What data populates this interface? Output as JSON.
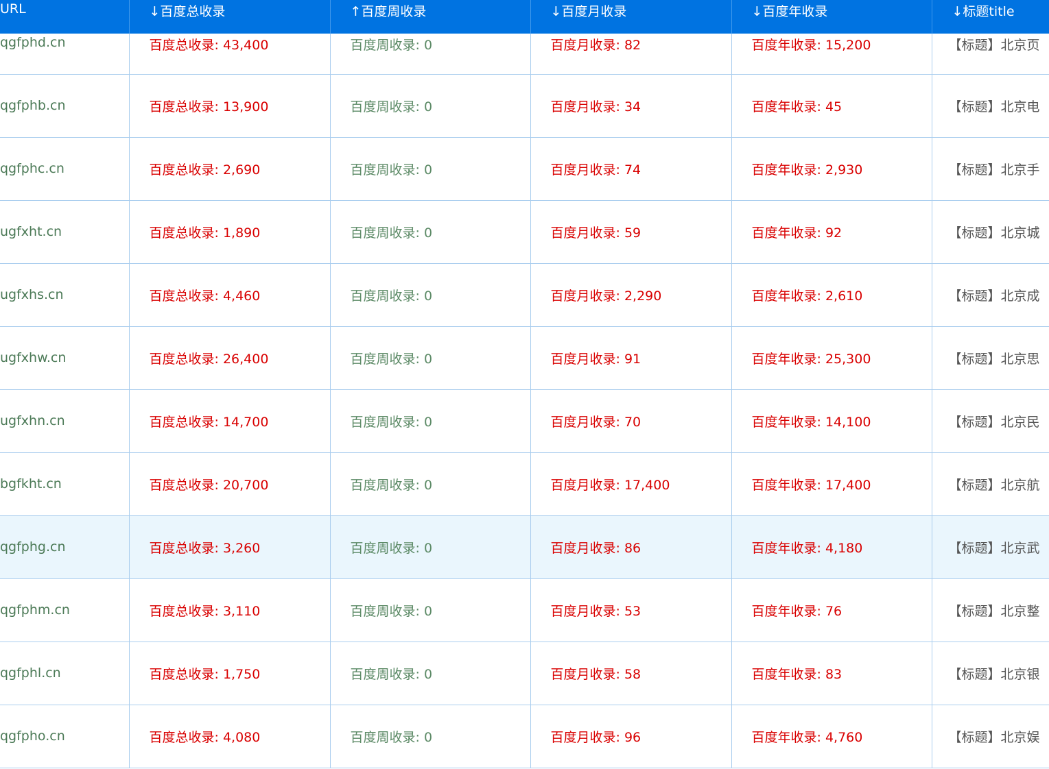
{
  "columns": [
    {
      "label": "URL"
    },
    {
      "label": "↓百度总收录"
    },
    {
      "label": "↑百度周收录"
    },
    {
      "label": "↓百度月收录"
    },
    {
      "label": "↓百度年收录"
    },
    {
      "label": "↓标题title"
    }
  ],
  "rows": [
    {
      "url": "qgfphd.cn",
      "total": "百度总收录: 43,400",
      "week": "百度周收录: 0",
      "month": "百度月收录: 82",
      "year": "百度年收录: 15,200",
      "title": "【标题】北京页"
    },
    {
      "url": "qgfphb.cn",
      "total": "百度总收录: 13,900",
      "week": "百度周收录: 0",
      "month": "百度月收录: 34",
      "year": "百度年收录: 45",
      "title": "【标题】北京电"
    },
    {
      "url": "qgfphc.cn",
      "total": "百度总收录: 2,690",
      "week": "百度周收录: 0",
      "month": "百度月收录: 74",
      "year": "百度年收录: 2,930",
      "title": "【标题】北京手"
    },
    {
      "url": "ugfxht.cn",
      "total": "百度总收录: 1,890",
      "week": "百度周收录: 0",
      "month": "百度月收录: 59",
      "year": "百度年收录: 92",
      "title": "【标题】北京城"
    },
    {
      "url": "ugfxhs.cn",
      "total": "百度总收录: 4,460",
      "week": "百度周收录: 0",
      "month": "百度月收录: 2,290",
      "year": "百度年收录: 2,610",
      "title": "【标题】北京成"
    },
    {
      "url": "ugfxhw.cn",
      "total": "百度总收录: 26,400",
      "week": "百度周收录: 0",
      "month": "百度月收录: 91",
      "year": "百度年收录: 25,300",
      "title": "【标题】北京思"
    },
    {
      "url": "ugfxhn.cn",
      "total": "百度总收录: 14,700",
      "week": "百度周收录: 0",
      "month": "百度月收录: 70",
      "year": "百度年收录: 14,100",
      "title": "【标题】北京民"
    },
    {
      "url": "bgfkht.cn",
      "total": "百度总收录: 20,700",
      "week": "百度周收录: 0",
      "month": "百度月收录: 17,400",
      "year": "百度年收录: 17,400",
      "title": "【标题】北京航"
    },
    {
      "url": "qgfphg.cn",
      "total": "百度总收录: 3,260",
      "week": "百度周收录: 0",
      "month": "百度月收录: 86",
      "year": "百度年收录: 4,180",
      "title": "【标题】北京武"
    },
    {
      "url": "qgfphm.cn",
      "total": "百度总收录: 3,110",
      "week": "百度周收录: 0",
      "month": "百度月收录: 53",
      "year": "百度年收录: 76",
      "title": "【标题】北京整"
    },
    {
      "url": "qgfphl.cn",
      "total": "百度总收录: 1,750",
      "week": "百度周收录: 0",
      "month": "百度月收录: 58",
      "year": "百度年收录: 83",
      "title": "【标题】北京银"
    },
    {
      "url": "qgfpho.cn",
      "total": "百度总收录: 4,080",
      "week": "百度周收录: 0",
      "month": "百度月收录: 96",
      "year": "百度年收录: 4,760",
      "title": "【标题】北京娱"
    }
  ],
  "highlighted_row": 8,
  "colors": {
    "header_bg": "#0073e1",
    "url_text": "#4c7a57",
    "count_red": "#d90000",
    "week_green": "#5c8a66",
    "title_gray": "#555555",
    "row_highlight": "#eaf6fd",
    "grid_line": "#a9cdee"
  }
}
